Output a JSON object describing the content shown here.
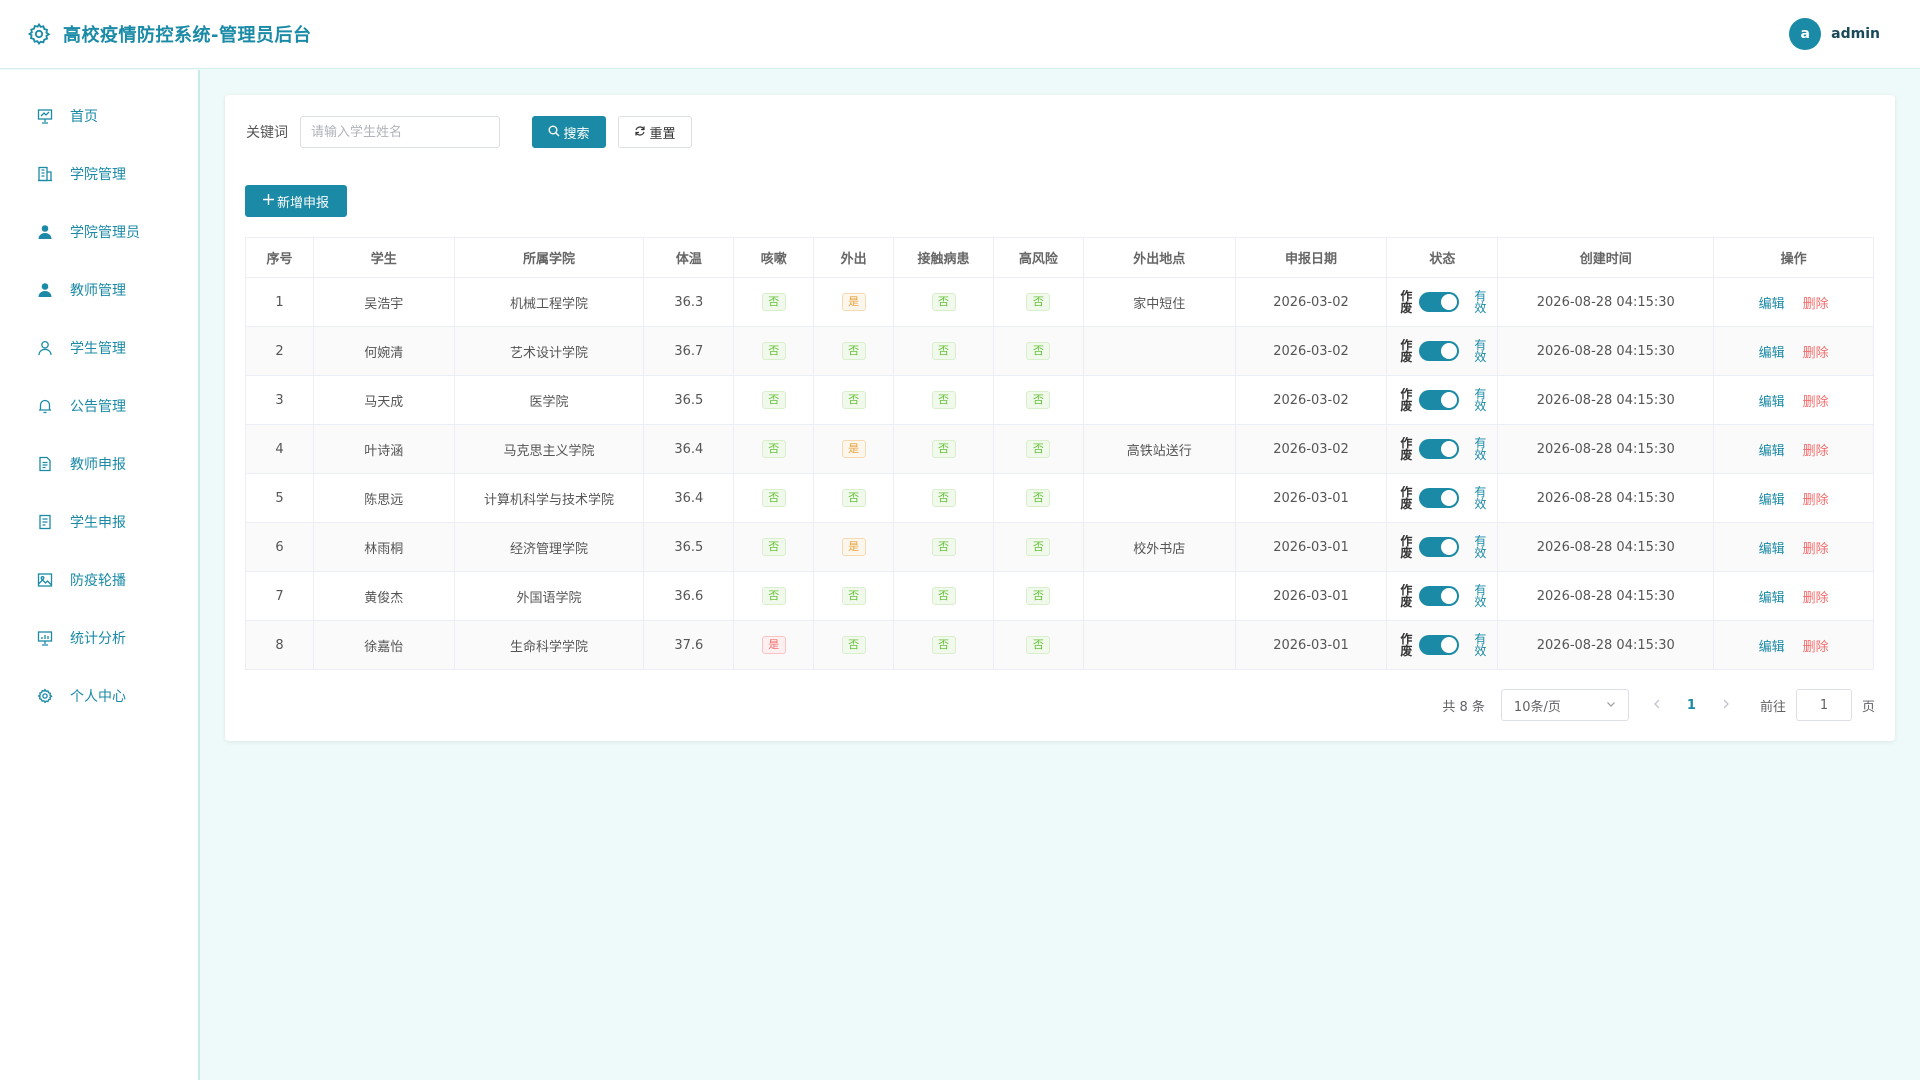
{
  "header": {
    "title": "高校疫情防控系统-管理员后台",
    "avatar_letter": "a",
    "username": "admin"
  },
  "sidebar": {
    "items": [
      {
        "label": "首页",
        "icon": "presentation-icon"
      },
      {
        "label": "学院管理",
        "icon": "building-icon"
      },
      {
        "label": "学院管理员",
        "icon": "user-filled-icon"
      },
      {
        "label": "教师管理",
        "icon": "user-filled-icon"
      },
      {
        "label": "学生管理",
        "icon": "user-outline-icon"
      },
      {
        "label": "公告管理",
        "icon": "bell-icon"
      },
      {
        "label": "教师申报",
        "icon": "document-icon"
      },
      {
        "label": "学生申报",
        "icon": "notebook-icon"
      },
      {
        "label": "防疫轮播",
        "icon": "picture-icon"
      },
      {
        "label": "统计分析",
        "icon": "chart-board-icon"
      },
      {
        "label": "个人中心",
        "icon": "gear-icon"
      }
    ]
  },
  "search": {
    "label": "关键词",
    "placeholder": "请输入学生姓名",
    "search_label": "搜索",
    "reset_label": "重置"
  },
  "add_label": "新增申报",
  "table": {
    "headers": [
      "序号",
      "学生",
      "所属学院",
      "体温",
      "咳嗽",
      "外出",
      "接触病患",
      "高风险",
      "外出地点",
      "申报日期",
      "状态",
      "创建时间",
      "操作"
    ],
    "status_off": "作废",
    "status_on": "有效",
    "edit_label": "编辑",
    "delete_label": "删除",
    "rows": [
      {
        "no": "1",
        "student": "吴浩宇",
        "college": "机械工程学院",
        "temp": "36.3",
        "cough": "否",
        "out": "是",
        "contact": "否",
        "risk": "否",
        "place": "家中短住",
        "date": "2026-03-02",
        "created": "2026-08-28 04:15:30"
      },
      {
        "no": "2",
        "student": "何婉清",
        "college": "艺术设计学院",
        "temp": "36.7",
        "cough": "否",
        "out": "否",
        "contact": "否",
        "risk": "否",
        "place": "",
        "date": "2026-03-02",
        "created": "2026-08-28 04:15:30"
      },
      {
        "no": "3",
        "student": "马天成",
        "college": "医学院",
        "temp": "36.5",
        "cough": "否",
        "out": "否",
        "contact": "否",
        "risk": "否",
        "place": "",
        "date": "2026-03-02",
        "created": "2026-08-28 04:15:30"
      },
      {
        "no": "4",
        "student": "叶诗涵",
        "college": "马克思主义学院",
        "temp": "36.4",
        "cough": "否",
        "out": "是",
        "contact": "否",
        "risk": "否",
        "place": "高铁站送行",
        "date": "2026-03-02",
        "created": "2026-08-28 04:15:30"
      },
      {
        "no": "5",
        "student": "陈思远",
        "college": "计算机科学与技术学院",
        "temp": "36.4",
        "cough": "否",
        "out": "否",
        "contact": "否",
        "risk": "否",
        "place": "",
        "date": "2026-03-01",
        "created": "2026-08-28 04:15:30"
      },
      {
        "no": "6",
        "student": "林雨桐",
        "college": "经济管理学院",
        "temp": "36.5",
        "cough": "否",
        "out": "是",
        "contact": "否",
        "risk": "否",
        "place": "校外书店",
        "date": "2026-03-01",
        "created": "2026-08-28 04:15:30"
      },
      {
        "no": "7",
        "student": "黄俊杰",
        "college": "外国语学院",
        "temp": "36.6",
        "cough": "否",
        "out": "否",
        "contact": "否",
        "risk": "否",
        "place": "",
        "date": "2026-03-01",
        "created": "2026-08-28 04:15:30"
      },
      {
        "no": "8",
        "student": "徐嘉怡",
        "college": "生命科学学院",
        "temp": "37.6",
        "cough": "是",
        "out": "否",
        "contact": "否",
        "risk": "否",
        "place": "",
        "date": "2026-03-01",
        "created": "2026-08-28 04:15:30"
      }
    ]
  },
  "pagination": {
    "total_text": "共 8 条",
    "page_size": "10条/页",
    "current_page": "1",
    "goto_label": "前往",
    "goto_value": "1",
    "page_suffix": "页"
  },
  "colors": {
    "primary": "#1a8aa6",
    "background": "#eefaf9",
    "tag_no": "#67c23a",
    "tag_yes_out": "#e6a23c",
    "tag_yes_cough": "#f56c6c",
    "delete": "#f56c6c"
  }
}
